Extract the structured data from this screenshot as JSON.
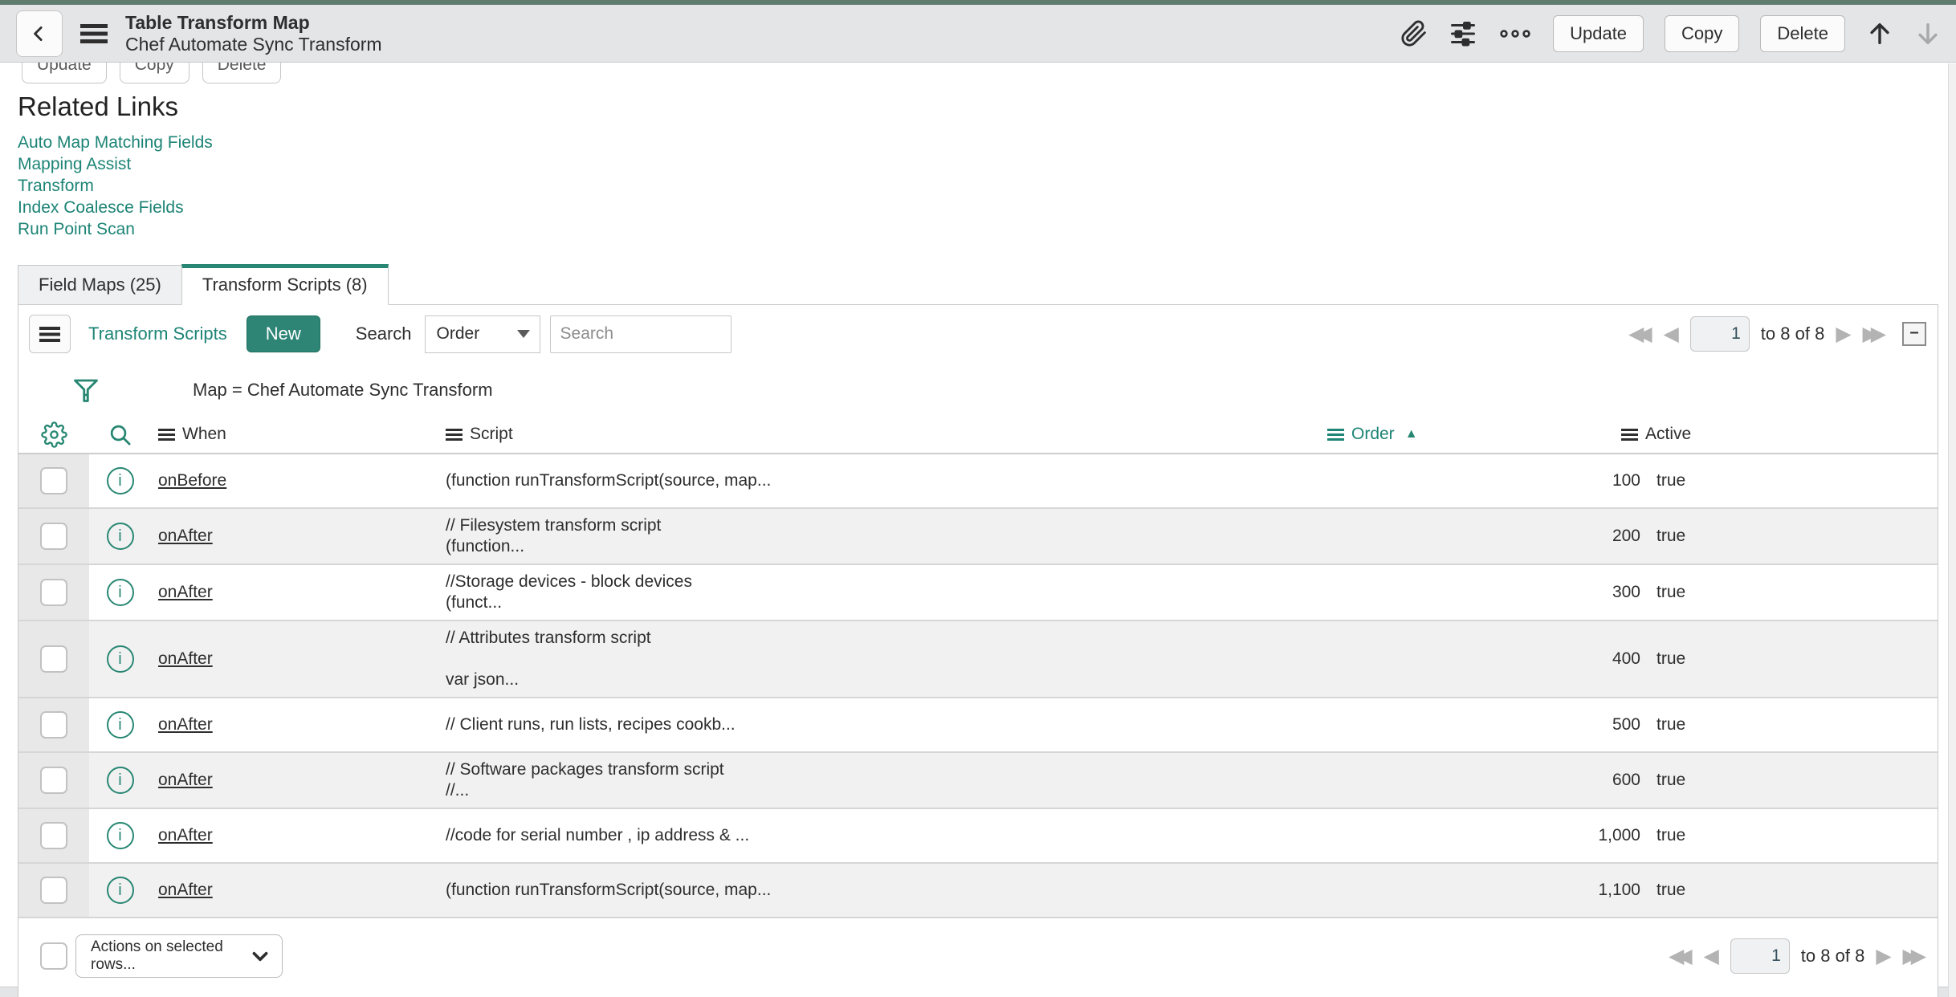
{
  "header": {
    "title": "Table Transform Map",
    "subtitle": "Chef Automate Sync Transform",
    "buttons": [
      "Update",
      "Copy",
      "Delete"
    ]
  },
  "form_buttons": [
    "Update",
    "Copy",
    "Delete"
  ],
  "related_links": {
    "heading": "Related Links",
    "links": [
      "Auto Map Matching Fields",
      "Mapping Assist",
      "Transform",
      "Index Coalesce Fields",
      "Run Point Scan"
    ]
  },
  "tabs": {
    "field_maps": "Field Maps (25)",
    "transform_scripts": "Transform Scripts (8)"
  },
  "list": {
    "title": "Transform Scripts",
    "new_button": "New",
    "search_label": "Search",
    "search_column": "Order",
    "search_placeholder": "Search",
    "filter_text": "Map = Chef Automate Sync Transform",
    "columns": {
      "when": "When",
      "script": "Script",
      "order": "Order",
      "active": "Active"
    },
    "sort": {
      "column": "Order",
      "direction": "ascending"
    },
    "pagination": {
      "page": "1",
      "range_label": "to 8 of 8"
    },
    "actions_label": "Actions on selected rows...",
    "rows": [
      {
        "when": "onBefore",
        "script_lines": [
          "(function runTransformScript(source, map..."
        ],
        "order": "100",
        "active": "true"
      },
      {
        "when": "onAfter",
        "script_lines": [
          "// Filesystem transform script",
          "(function..."
        ],
        "order": "200",
        "active": "true"
      },
      {
        "when": "onAfter",
        "script_lines": [
          "//Storage devices - block devices",
          "(funct..."
        ],
        "order": "300",
        "active": "true"
      },
      {
        "when": "onAfter",
        "script_lines": [
          "// Attributes transform script",
          "",
          "var json..."
        ],
        "order": "400",
        "active": "true"
      },
      {
        "when": "onAfter",
        "script_lines": [
          "// Client runs, run lists, recipes cookb..."
        ],
        "order": "500",
        "active": "true"
      },
      {
        "when": "onAfter",
        "script_lines": [
          "// Software packages transform script",
          "//..."
        ],
        "order": "600",
        "active": "true"
      },
      {
        "when": "onAfter",
        "script_lines": [
          "//code for serial number , ip address & ..."
        ],
        "order": "1,000",
        "active": "true"
      },
      {
        "when": "onAfter",
        "script_lines": [
          "(function runTransformScript(source, map..."
        ],
        "order": "1,100",
        "active": "true"
      }
    ]
  },
  "colors": {
    "accent": "#278772",
    "link": "#1d8476",
    "header_bg": "#e4e5e7",
    "row_stripe": "#f1f1f1"
  }
}
